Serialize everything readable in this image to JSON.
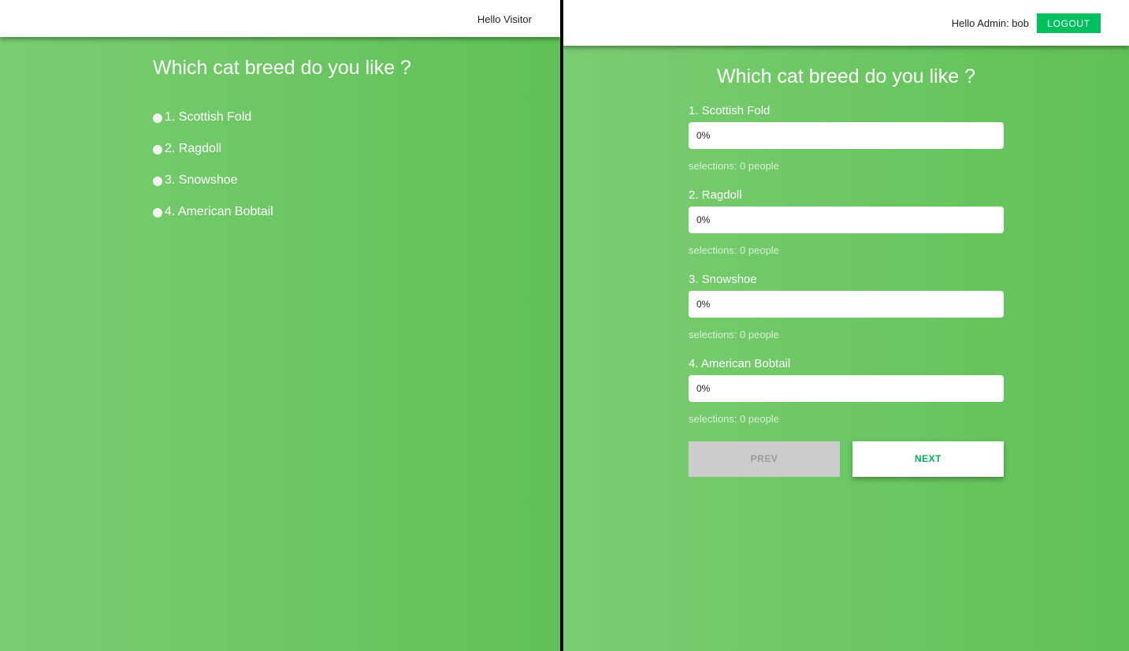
{
  "visitor": {
    "greeting": "Hello Visitor",
    "question": "Which cat breed do you like ?",
    "options": [
      {
        "label": "1. Scottish Fold"
      },
      {
        "label": "2. Ragdoll"
      },
      {
        "label": "3. Snowshoe"
      },
      {
        "label": "4. American Bobtail"
      }
    ]
  },
  "admin": {
    "greeting": "Hello Admin: bob",
    "logout_label": "LOGOUT",
    "question": "Which cat breed do you like ?",
    "results": [
      {
        "label": "1. Scottish Fold",
        "percent_text": "0%",
        "percent": 0,
        "selections": "selections: 0 people"
      },
      {
        "label": "2. Ragdoll",
        "percent_text": "0%",
        "percent": 0,
        "selections": "selections: 0 people"
      },
      {
        "label": "3. Snowshoe",
        "percent_text": "0%",
        "percent": 0,
        "selections": "selections: 0 people"
      },
      {
        "label": "4. American Bobtail",
        "percent_text": "0%",
        "percent": 0,
        "selections": "selections: 0 people"
      }
    ],
    "prev_label": "PREV",
    "next_label": "NEXT"
  },
  "colors": {
    "accent": "#00c060",
    "background_start": "#7acd72",
    "background_end": "#5fc155"
  }
}
